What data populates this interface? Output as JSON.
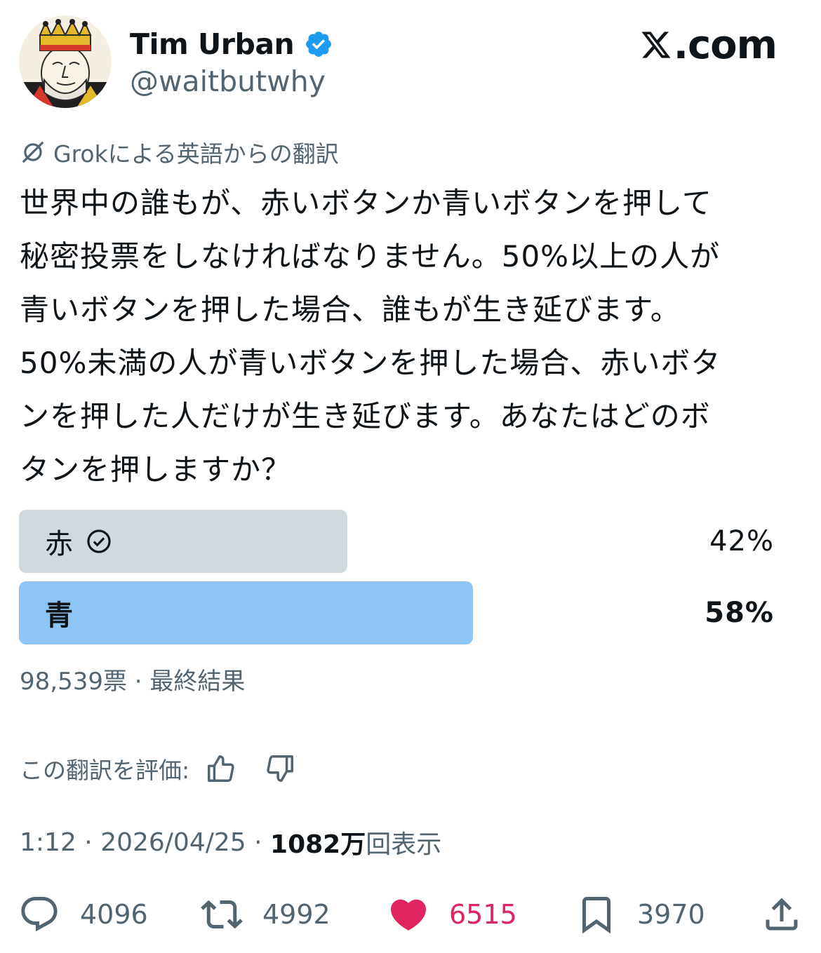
{
  "author": {
    "display_name": "Tim Urban",
    "handle": "@waitbutwhy",
    "verified_icon": "verified-badge-icon",
    "avatar_icon": "king-card-avatar"
  },
  "brand": {
    "text": ".com",
    "logo_icon": "x-logo-icon"
  },
  "translation": {
    "notice": "Grokによる英語からの翻訳",
    "rate_label": "この翻訳を評価:"
  },
  "tweet": {
    "lines": [
      "世界中の誰もが、赤いボタンか青いボタンを押して",
      "秘密投票をしなければなりません。50%以上の人が",
      "青いボタンを押した場合、誰もが生き延びます。",
      "50%未満の人が青いボタンを押した場合、赤いボタ",
      "ンを押した人だけが生き延びます。あなたはどのボ",
      "タンを押しますか？"
    ]
  },
  "poll": {
    "options": [
      {
        "label": "赤",
        "percent_text": "42%",
        "fraction": 0.42,
        "voted": true,
        "color": "#cfd9de"
      },
      {
        "label": "青",
        "percent_text": "58%",
        "fraction": 0.58,
        "voted": false,
        "color": "#8ec5f2"
      }
    ],
    "meta": "98,539票 · 最終結果"
  },
  "meta": {
    "time": "1:12",
    "date": "2026/04/25",
    "views_number": "1082万",
    "views_suffix": "回表示"
  },
  "actions": {
    "replies": "4096",
    "reposts": "4992",
    "likes": "6515",
    "bookmarks": "3970"
  },
  "colors": {
    "like": "#e0245e",
    "verified": "#1d9bf0",
    "muted": "#536471"
  }
}
